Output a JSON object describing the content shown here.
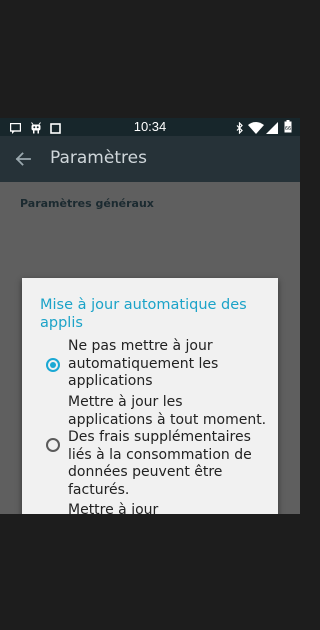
{
  "status_bar": {
    "time": "10:34",
    "left_icons": [
      "message-notification-icon",
      "android-debug-icon",
      "screenshot-icon"
    ],
    "right_icons": [
      "bluetooth-icon",
      "wifi-icon",
      "cell-signal-icon",
      "battery-icon"
    ]
  },
  "app_bar": {
    "back_icon": "arrow-back-icon",
    "title": "Paramètres"
  },
  "content": {
    "section_header": "Paramètres généraux"
  },
  "dialog": {
    "title": "Mise à jour automatique des applis",
    "options": [
      {
        "label": "Ne pas mettre à jour automatiquement les applications",
        "selected": true
      },
      {
        "label": "Mettre à jour les applications à tout moment. Des frais supplémentaires liés à la consommation de données peuvent être facturés.",
        "selected": false
      },
      {
        "label": "Mettre à jour automatiquement les applications via Wi-Fi uniquement",
        "selected": false
      }
    ]
  },
  "colors": {
    "status_bar": "#17262b",
    "app_bar": "#263238",
    "accent": "#1aa8d4",
    "dialog_background": "#f1f1f1",
    "scrim": "#5f5f5f"
  }
}
